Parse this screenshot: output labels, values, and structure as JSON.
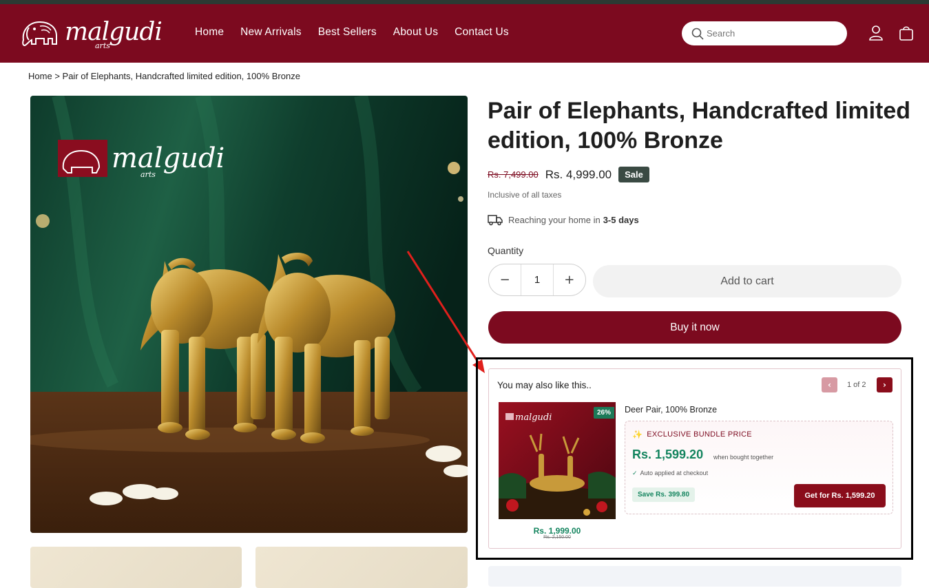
{
  "brand": {
    "name": "malgudi",
    "sub": "arts"
  },
  "nav": [
    "Home",
    "New Arrivals",
    "Best Sellers",
    "About Us",
    "Contact Us"
  ],
  "search": {
    "placeholder": "Search"
  },
  "breadcrumb": {
    "home": "Home",
    "separator": ">",
    "current": "Pair of Elephants, Handcrafted limited edition, 100% Bronze"
  },
  "product": {
    "title": "Pair of Elephants, Handcrafted limited edition, 100% Bronze",
    "old_price": "Rs. 7,499.00",
    "price": "Rs. 4,999.00",
    "sale_label": "Sale",
    "tax_note": "Inclusive of all taxes",
    "delivery_text": "Reaching your home in",
    "delivery_days": "3-5 days",
    "image_logo_main": "malgudi",
    "image_logo_sub": "arts"
  },
  "quantity": {
    "label": "Quantity",
    "value": "1",
    "minus": "−",
    "plus": "+"
  },
  "buttons": {
    "add_to_cart": "Add to cart",
    "buy_now": "Buy it now"
  },
  "recommend": {
    "heading": "You may also like this..",
    "prev": "‹",
    "next": "›",
    "page": "1 of 2",
    "item": {
      "name": "Deer Pair, 100% Bronze",
      "discount": "26%",
      "price": "Rs. 1,999.00",
      "old_price": "Rs. 2,150.00",
      "image_logo": "malgudi"
    },
    "bundle": {
      "tag": "EXCLUSIVE BUNDLE PRICE",
      "price": "Rs. 1,599.20",
      "when": "when bought together",
      "auto": "Auto applied at checkout",
      "save": "Save Rs. 399.80",
      "cta": "Get for Rs. 1,599.20"
    }
  },
  "colors": {
    "brand": "#7c0a1f",
    "green": "#13845e",
    "sale_badge": "#3a4a43"
  }
}
